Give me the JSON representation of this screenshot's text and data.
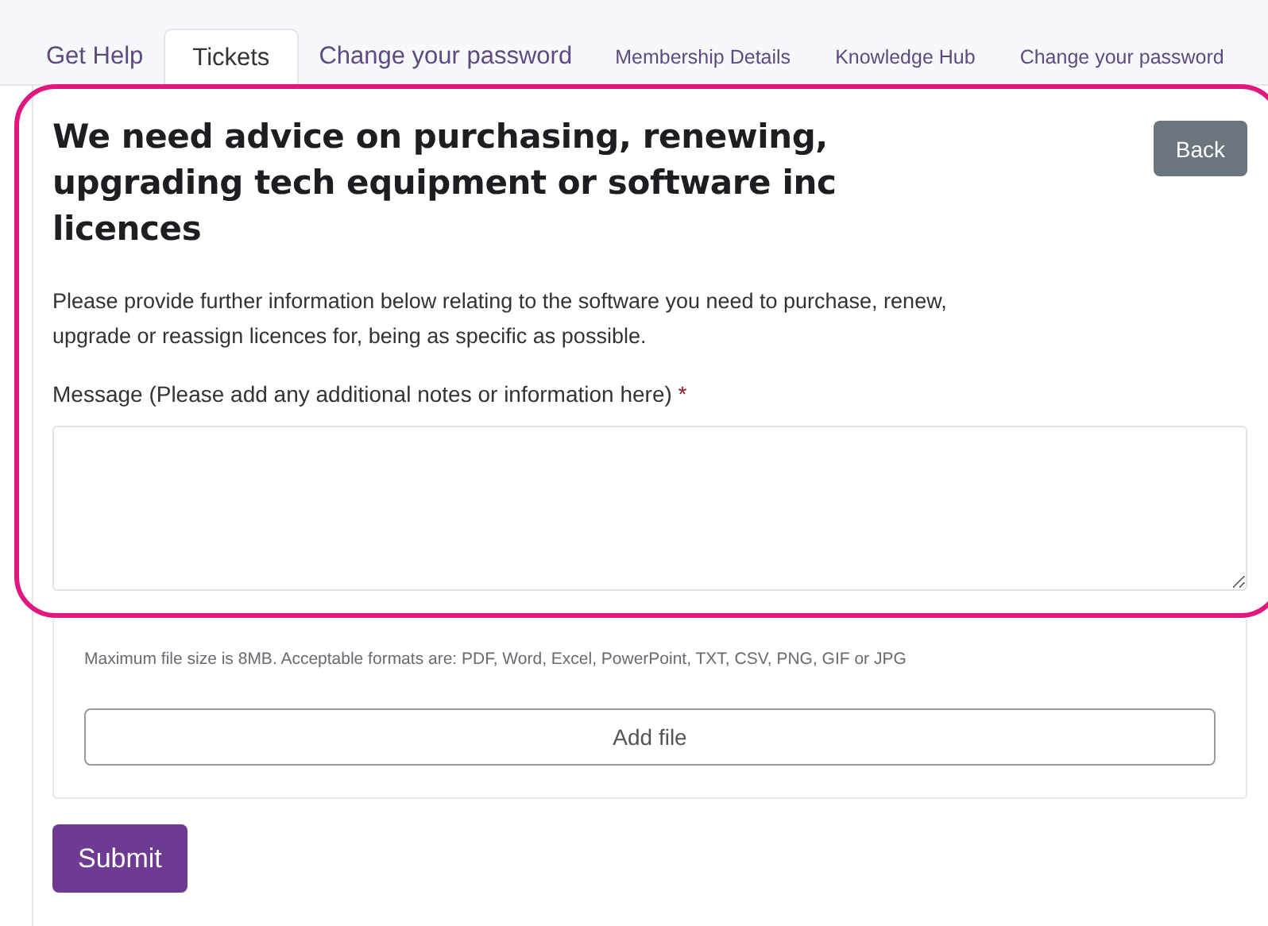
{
  "tabs": [
    {
      "label": "Get Help",
      "selected": false,
      "kind": "large"
    },
    {
      "label": "Tickets",
      "selected": true,
      "kind": "large"
    },
    {
      "label": "Change your password",
      "selected": false,
      "kind": "large"
    },
    {
      "label": "Membership Details",
      "selected": false,
      "kind": "small"
    },
    {
      "label": "Knowledge Hub",
      "selected": false,
      "kind": "small"
    },
    {
      "label": "Change your password",
      "selected": false,
      "kind": "small"
    }
  ],
  "form": {
    "title": "We need advice on purchasing, renewing, upgrading tech equipment or software inc licences",
    "back_button": "Back",
    "description": "Please provide further information below relating to the software you need to purchase, renew, upgrade or reassign licences for, being as specific as possible.",
    "message_label": "Message (Please add any additional notes or information here)",
    "required_mark": "*",
    "file_note": "Maximum file size is 8MB. Acceptable formats are: PDF, Word, Excel, PowerPoint, TXT, CSV, PNG, GIF or JPG",
    "add_file_button": "Add file",
    "submit_button": "Submit"
  }
}
